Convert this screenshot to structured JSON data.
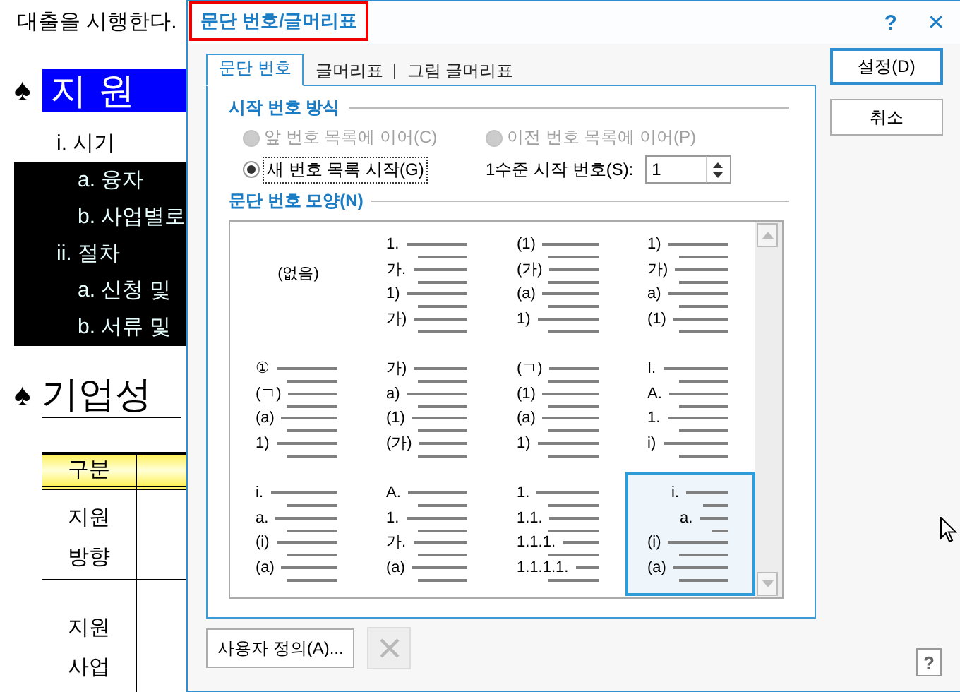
{
  "document": {
    "paragraph": "대출을 시행한다.",
    "heading_1": {
      "bullet": "♠",
      "text": "지원"
    },
    "outline": [
      {
        "kind": "roman",
        "text": "i. 시기",
        "selected": false
      },
      {
        "kind": "alpha",
        "text": "a. 융자",
        "selected": true
      },
      {
        "kind": "alpha",
        "text": "b. 사업별로",
        "selected": true
      },
      {
        "kind": "roman",
        "text": "ii. 절차",
        "selected": true
      },
      {
        "kind": "alpha",
        "text": "a. 신청 및",
        "selected": true
      },
      {
        "kind": "alpha",
        "text": "b. 서류 및",
        "selected": true
      }
    ],
    "heading_2": {
      "bullet": "♠",
      "text": "기업성"
    },
    "table": {
      "columns": [
        "구분"
      ],
      "rows": [
        "지원 방향",
        "지원 사업"
      ]
    }
  },
  "dialog": {
    "title": "문단 번호/글머리표",
    "help": "?",
    "close": "✕",
    "tabs": [
      {
        "label": "문단 번호",
        "selected": true
      },
      {
        "label": "글머리표",
        "selected": false
      },
      {
        "label": "그림 글머리표",
        "selected": false
      }
    ],
    "start_group": {
      "title": "시작 번호 방식",
      "options": [
        {
          "label": "앞 번호 목록에 이어(C)",
          "selected": false,
          "disabled": true
        },
        {
          "label": "이전 번호 목록에 이어(P)",
          "selected": false,
          "disabled": true
        },
        {
          "label": "새 번호 목록 시작(G)",
          "selected": true,
          "disabled": false
        }
      ],
      "start_number": {
        "label": "1수준 시작 번호(S):",
        "value": "1"
      }
    },
    "shape_group": {
      "title": "문단 번호 모양(N)",
      "styles": [
        {
          "kind": "none",
          "labels": [
            "(없음)"
          ],
          "selected": false
        },
        {
          "kind": "flat",
          "labels": [
            "1.",
            "가.",
            "1)",
            "가)"
          ],
          "selected": false
        },
        {
          "kind": "flat",
          "labels": [
            "(1)",
            "(가)",
            "(a)",
            "1)"
          ],
          "selected": false
        },
        {
          "kind": "flat",
          "labels": [
            "1)",
            "가)",
            "a)",
            "(1)"
          ],
          "selected": false
        },
        {
          "kind": "flat",
          "labels": [
            "①",
            "(ㄱ)",
            "(a)",
            "1)"
          ],
          "selected": false
        },
        {
          "kind": "flat",
          "labels": [
            "가)",
            "a)",
            "(1)",
            "(가)"
          ],
          "selected": false
        },
        {
          "kind": "flat",
          "labels": [
            "(ㄱ)",
            "(1)",
            "(a)",
            "1)"
          ],
          "selected": false
        },
        {
          "kind": "flat",
          "labels": [
            "I.",
            "A.",
            "1.",
            "i)"
          ],
          "selected": false
        },
        {
          "kind": "flat",
          "labels": [
            "i.",
            "a.",
            "(i)",
            "(a)"
          ],
          "selected": false
        },
        {
          "kind": "flat",
          "labels": [
            "A.",
            "1.",
            "가.",
            "(a)"
          ],
          "selected": false
        },
        {
          "kind": "flat",
          "labels": [
            "1.",
            "1.1.",
            "1.1.1.",
            "1.1.1.1."
          ],
          "selected": false
        },
        {
          "kind": "stepped",
          "labels": [
            "i.",
            "a.",
            "(i)",
            "(a)"
          ],
          "selected": true
        }
      ]
    },
    "buttons": [
      {
        "label": "설정(D)",
        "default": true
      },
      {
        "label": "취소",
        "default": false
      }
    ],
    "custom_button": {
      "label": "사용자 정의(A)..."
    },
    "delete_button": {
      "disabled": true
    },
    "help_button": {
      "label": "?"
    }
  }
}
